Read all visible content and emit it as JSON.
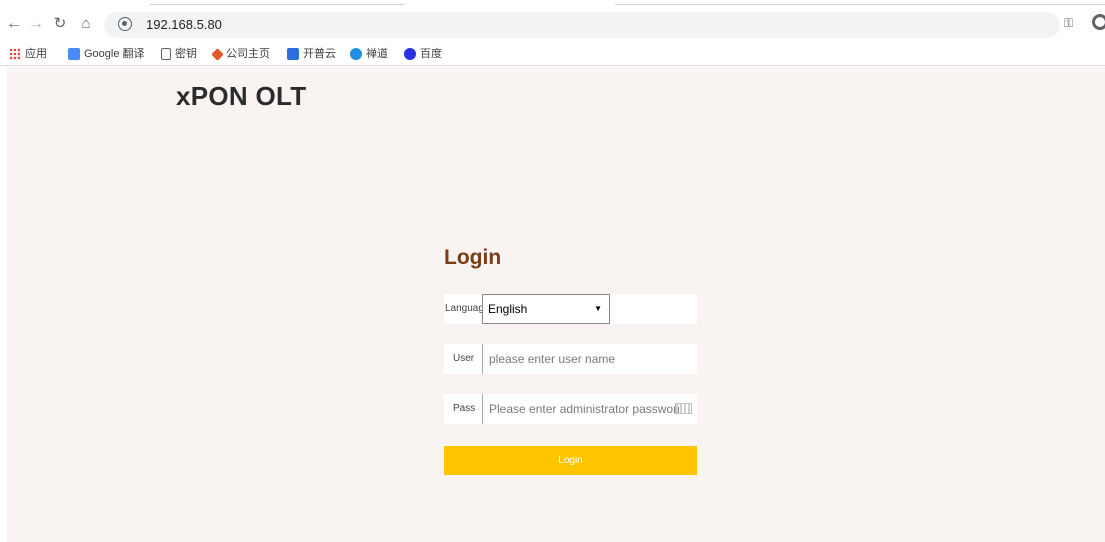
{
  "browser": {
    "url": "192.168.5.80",
    "bookmarks": [
      "应用",
      "Google 翻译",
      "密钥",
      "公司主页",
      "开普云",
      "禅道",
      "百度"
    ]
  },
  "page": {
    "brand": "xPON OLT",
    "login_title": "Login",
    "language_label": "Language",
    "language_value": "English",
    "user_label": "User",
    "user_placeholder": "please enter user name",
    "pass_label": "Pass",
    "pass_placeholder": "Please enter administrator password",
    "login_button": "Login"
  },
  "colors": {
    "background": "#f9f4f1",
    "title": "#7a3c17",
    "button": "#ffc400"
  },
  "icons": [
    "back-icon",
    "forward-icon",
    "reload-icon",
    "home-icon",
    "site-info-icon",
    "key-icon",
    "profile-icon",
    "keyboard-icon"
  ]
}
